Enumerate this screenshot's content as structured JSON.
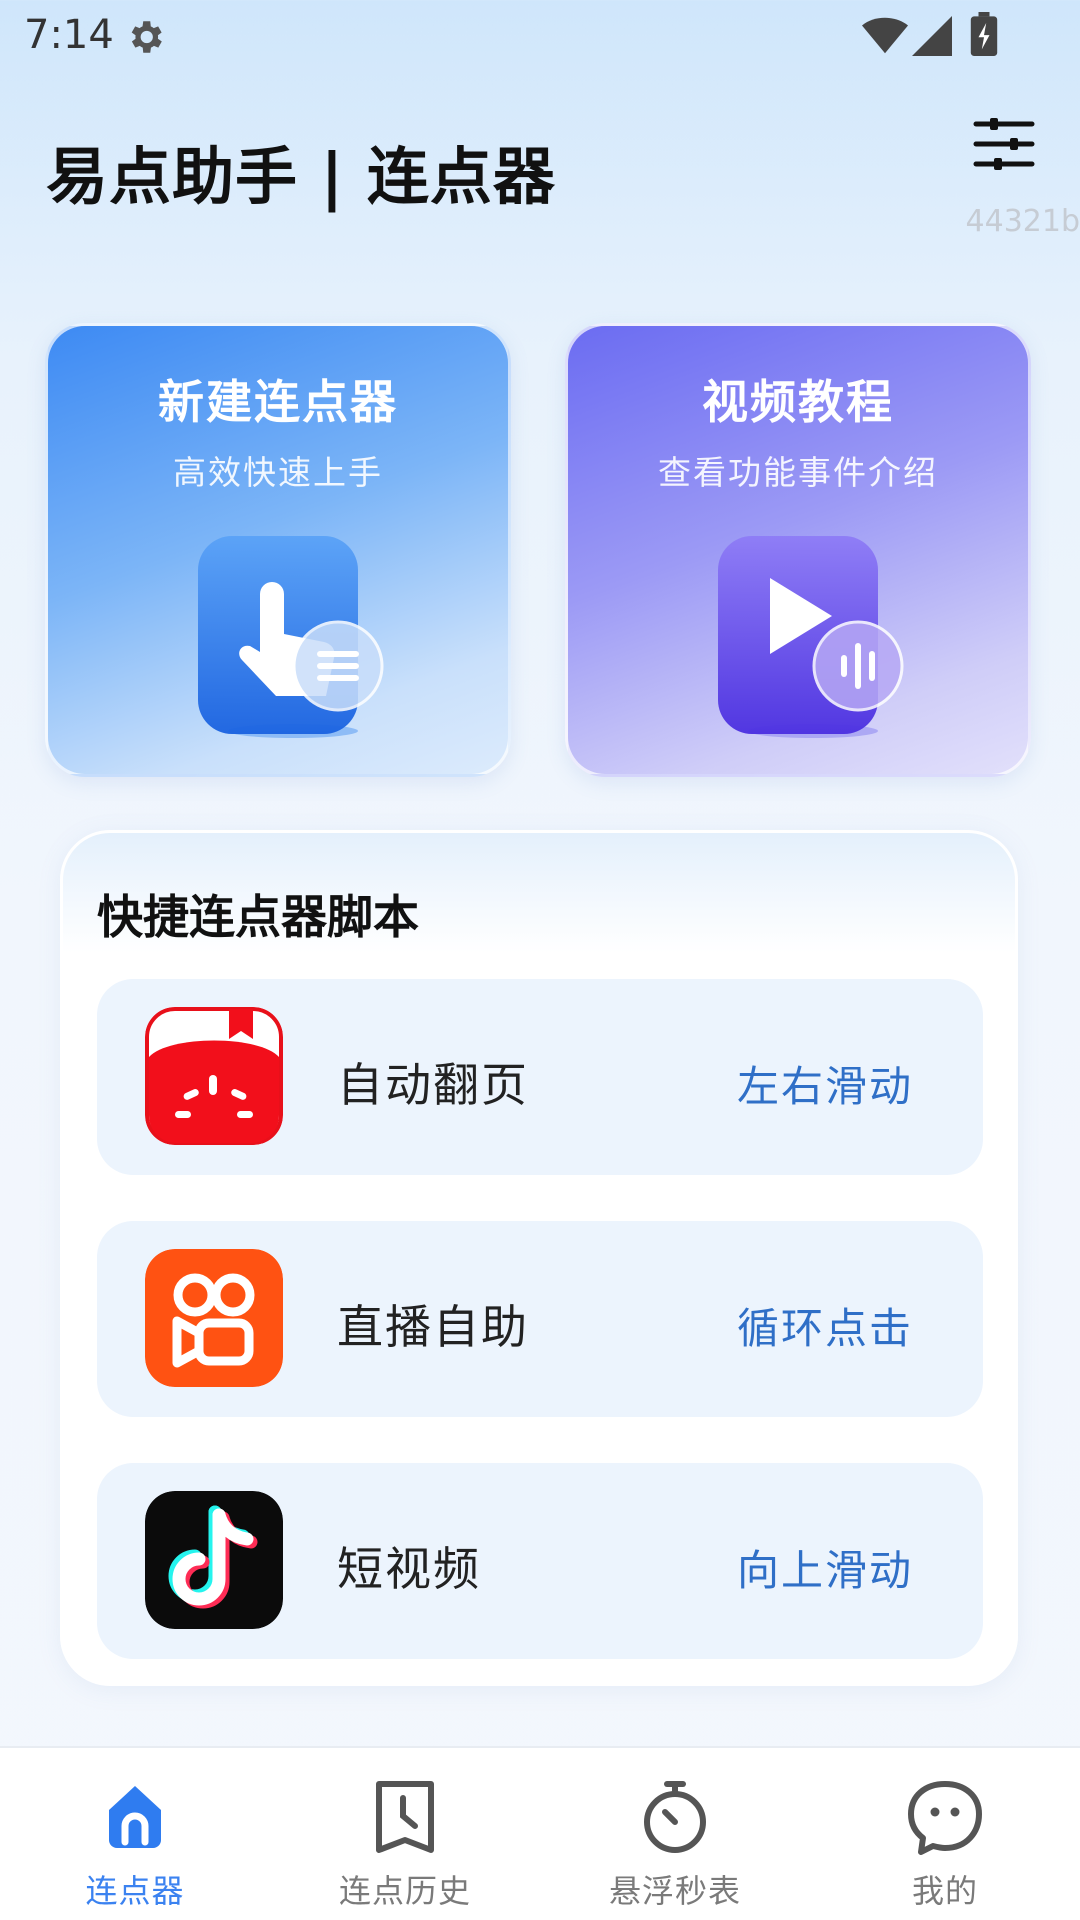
{
  "status_bar": {
    "time": "7:14",
    "icons": [
      "gear-icon",
      "wifi-icon",
      "signal-icon",
      "battery-charging-icon"
    ]
  },
  "header": {
    "title": "易点助手 | 连点器",
    "menu_icon": "sliders-icon",
    "version_code": "44321b"
  },
  "feature_cards": [
    {
      "title": "新建连点器",
      "subtitle": "高效快速上手",
      "icon": "tap-hand-icon",
      "color": "#3d8af3"
    },
    {
      "title": "视频教程",
      "subtitle": "查看功能事件介绍",
      "icon": "play-video-icon",
      "color": "#6b6cf2"
    }
  ],
  "scripts": {
    "title": "快捷连点器脚本",
    "items": [
      {
        "name": "自动翻页",
        "action": "左右滑动",
        "icon": "tomato-novel-app-icon"
      },
      {
        "name": "直播自助",
        "action": "循环点击",
        "icon": "kuaishou-app-icon"
      },
      {
        "name": "短视频",
        "action": "向上滑动",
        "icon": "douyin-app-icon"
      }
    ]
  },
  "bottom_nav": {
    "active_color": "#3b82f0",
    "items": [
      {
        "label": "连点器",
        "icon": "home-icon",
        "active": true
      },
      {
        "label": "连点历史",
        "icon": "history-clock-icon",
        "active": false
      },
      {
        "label": "悬浮秒表",
        "icon": "stopwatch-icon",
        "active": false
      },
      {
        "label": "我的",
        "icon": "profile-face-icon",
        "active": false
      }
    ]
  }
}
